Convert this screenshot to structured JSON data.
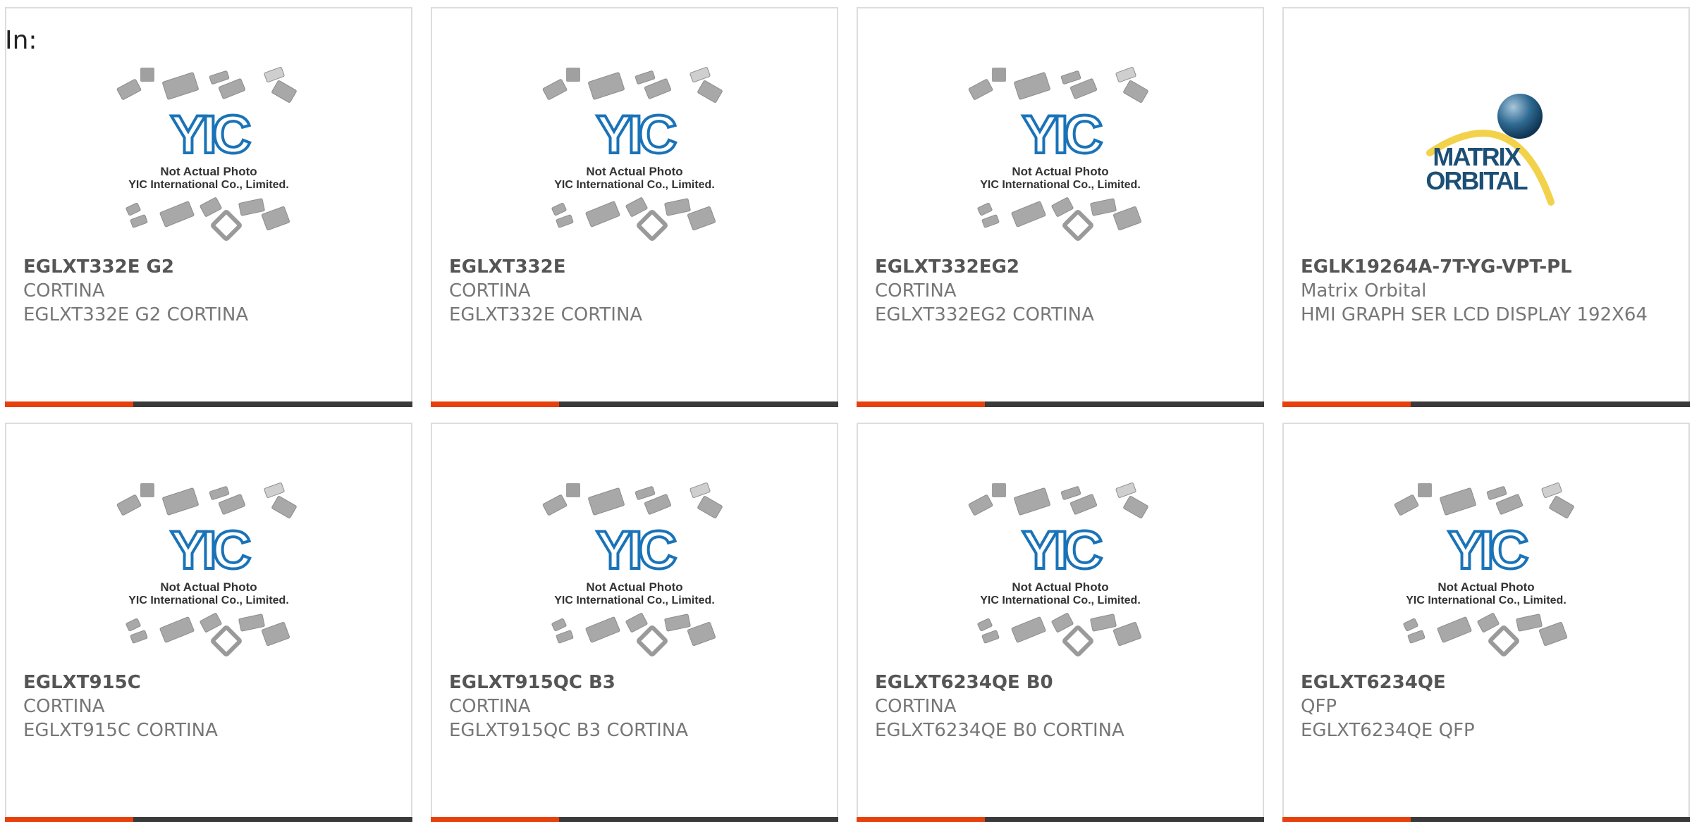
{
  "page": {
    "in_label": "In:"
  },
  "placeholder": {
    "line1": "Not Actual Photo",
    "line2": "YIC International Co., Limited.",
    "logo_text": "YIC"
  },
  "matrix_logo": {
    "line1": "MATRIX",
    "line2": "ORBITAL"
  },
  "colors": {
    "accent": "#e8400c",
    "bar": "#3a3a3a",
    "yic_blue": "#1a73b8"
  },
  "products": [
    {
      "part": "EGLXT332E G2",
      "manufacturer": "CORTINA",
      "description": "EGLXT332E G2 CORTINA",
      "image": "yic-placeholder"
    },
    {
      "part": "EGLXT332E",
      "manufacturer": "CORTINA",
      "description": "EGLXT332E CORTINA",
      "image": "yic-placeholder"
    },
    {
      "part": "EGLXT332EG2",
      "manufacturer": "CORTINA",
      "description": "EGLXT332EG2 CORTINA",
      "image": "yic-placeholder"
    },
    {
      "part": "EGLK19264A-7T-YG-VPT-PL",
      "manufacturer": "Matrix Orbital",
      "description": "HMI GRAPH SER LCD DISPLAY 192X64",
      "image": "matrix-orbital-logo"
    },
    {
      "part": "EGLXT915C",
      "manufacturer": "CORTINA",
      "description": "EGLXT915C CORTINA",
      "image": "yic-placeholder"
    },
    {
      "part": "EGLXT915QC B3",
      "manufacturer": "CORTINA",
      "description": "EGLXT915QC B3 CORTINA",
      "image": "yic-placeholder"
    },
    {
      "part": "EGLXT6234QE B0",
      "manufacturer": "CORTINA",
      "description": "EGLXT6234QE B0 CORTINA",
      "image": "yic-placeholder"
    },
    {
      "part": "EGLXT6234QE",
      "manufacturer": "QFP",
      "description": "EGLXT6234QE QFP",
      "image": "yic-placeholder"
    }
  ]
}
